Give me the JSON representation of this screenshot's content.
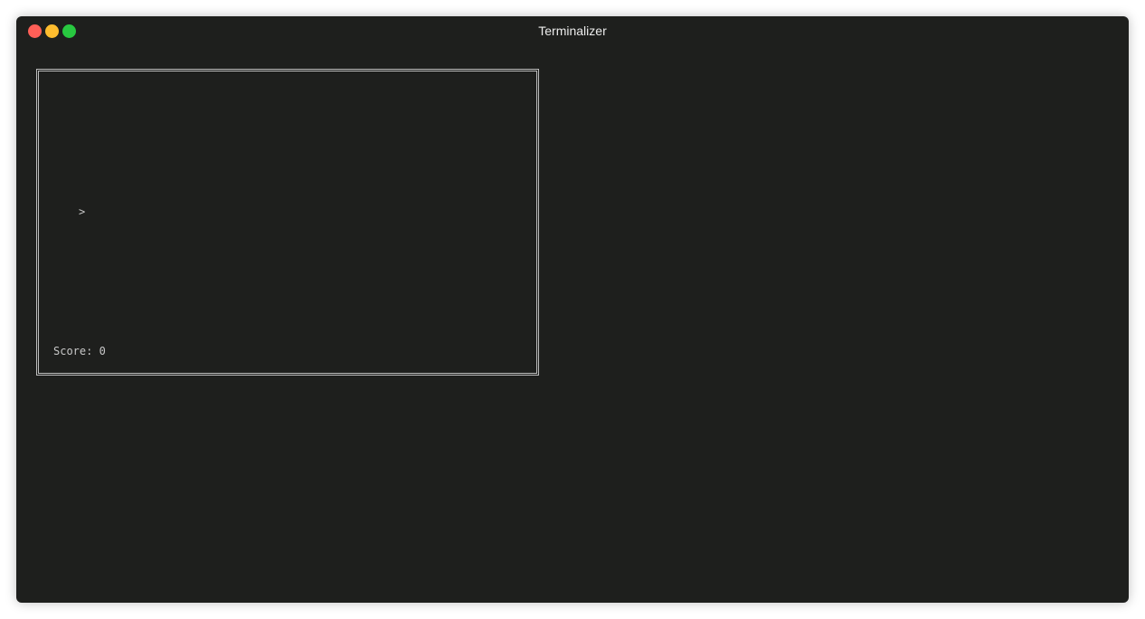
{
  "window": {
    "title": "Terminalizer",
    "traffic_lights": {
      "close_color": "#ff5f57",
      "minimize_color": "#febc2e",
      "maximize_color": "#28c840"
    }
  },
  "terminal": {
    "background": "#1e1f1d",
    "game": {
      "player_glyph": ">",
      "score_label": "Score: 0"
    }
  }
}
